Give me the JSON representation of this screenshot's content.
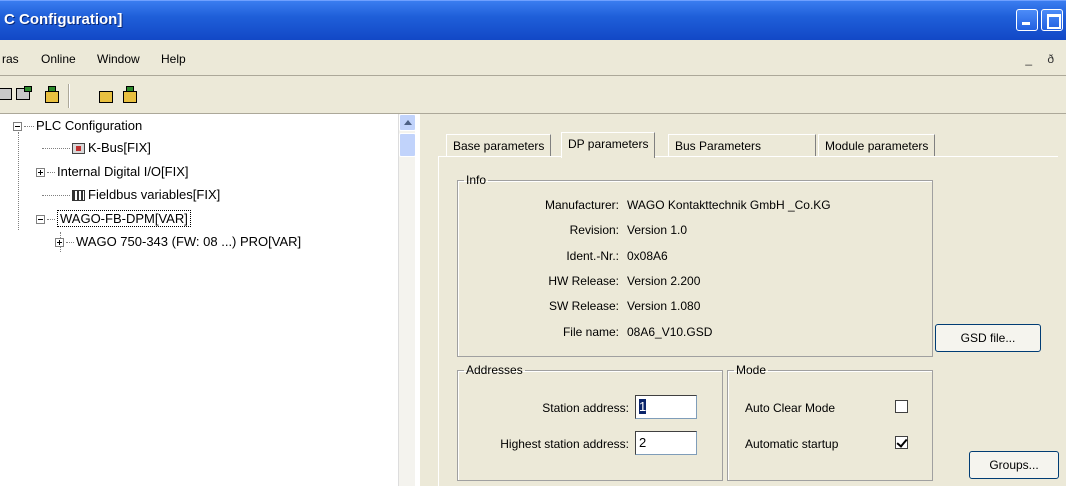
{
  "window": {
    "title": "C Configuration]"
  },
  "menu": {
    "items": [
      "ras",
      "Online",
      "Window",
      "Help"
    ],
    "mdi_controls": "_ ð"
  },
  "tree": {
    "items": [
      {
        "label": "PLC Configuration"
      },
      {
        "label": "K-Bus[FIX]"
      },
      {
        "label": "Internal Digital I/O[FIX]"
      },
      {
        "label": "Fieldbus variables[FIX]"
      },
      {
        "label": "WAGO-FB-DPM[VAR]"
      },
      {
        "label": "WAGO 750-343 (FW: 08 ...) PRO[VAR]"
      }
    ]
  },
  "tabs": [
    "Base parameters",
    "DP parameters",
    "Bus Parameters",
    "Module parameters"
  ],
  "info": {
    "legend": "Info",
    "rows": [
      {
        "label": "Manufacturer:",
        "value": "WAGO Kontakttechnik GmbH _Co.KG"
      },
      {
        "label": "Revision:",
        "value": "Version 1.0"
      },
      {
        "label": "Ident.-Nr.:",
        "value": "0x08A6"
      },
      {
        "label": "HW Release:",
        "value": "Version 2.200"
      },
      {
        "label": "SW Release:",
        "value": "Version 1.080"
      },
      {
        "label": "File name:",
        "value": "08A6_V10.GSD"
      }
    ]
  },
  "addresses": {
    "legend": "Addresses",
    "station_label": "Station address:",
    "station_value": "1",
    "highest_label": "Highest station address:",
    "highest_value": "2"
  },
  "mode": {
    "legend": "Mode",
    "auto_clear_label": "Auto Clear Mode",
    "auto_clear_checked": false,
    "auto_start_label": "Automatic startup",
    "auto_start_checked": true
  },
  "buttons": {
    "gsd": "GSD file...",
    "groups": "Groups..."
  }
}
